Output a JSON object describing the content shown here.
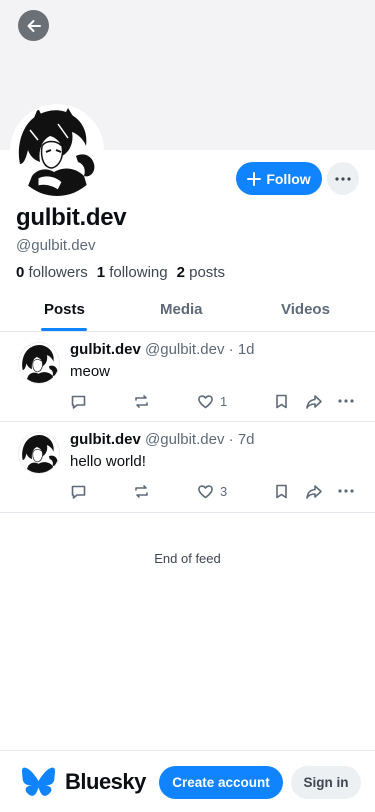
{
  "profile": {
    "display_name": "gulbit.dev",
    "handle": "@gulbit.dev",
    "followers_count": "0",
    "followers_label": "followers",
    "following_count": "1",
    "following_label": "following",
    "posts_count": "2",
    "posts_label": "posts",
    "follow_label": "Follow"
  },
  "tabs": [
    {
      "label": "Posts",
      "active": true
    },
    {
      "label": "Media",
      "active": false
    },
    {
      "label": "Videos",
      "active": false
    }
  ],
  "posts": [
    {
      "name": "gulbit.dev",
      "handle": "@gulbit.dev",
      "dot": "·",
      "time": "1d",
      "text": "meow",
      "likes": "1"
    },
    {
      "name": "gulbit.dev",
      "handle": "@gulbit.dev",
      "dot": "·",
      "time": "7d",
      "text": "hello world!",
      "likes": "3"
    }
  ],
  "feed": {
    "end_label": "End of feed"
  },
  "bottom_bar": {
    "brand_name": "Bluesky",
    "create_account_label": "Create account",
    "sign_in_label": "Sign in"
  },
  "colors": {
    "accent": "#1083fe",
    "muted_text": "#5e6a78",
    "divider": "#e4e7eb"
  },
  "icons": [
    "back-arrow-icon",
    "plus-icon",
    "ellipsis-icon",
    "reply-icon",
    "repost-icon",
    "heart-icon",
    "bookmark-icon",
    "share-icon",
    "butterfly-logo-icon"
  ]
}
